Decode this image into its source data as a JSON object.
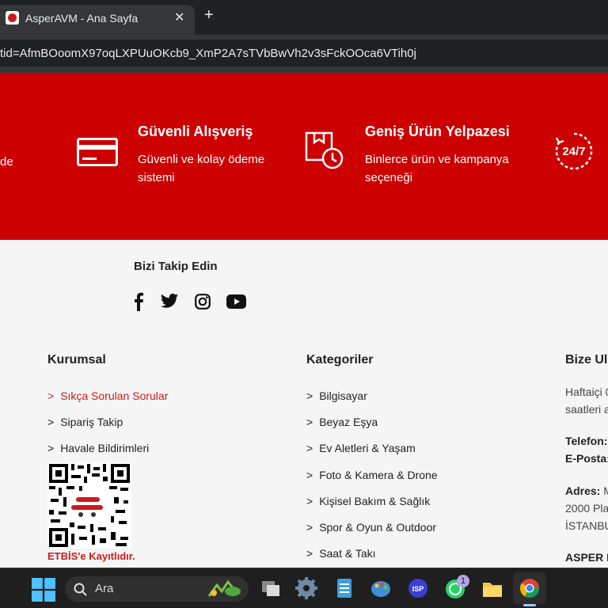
{
  "browser": {
    "tab_title": "AsperAVM - Ana Sayfa",
    "tab_close": "✕",
    "new_tab": "+",
    "url": "tid=AfmBOoomX97oqLXPUuOKcb9_XmP2A7sTVbBwVh2v3sFckOOca6VTih0j"
  },
  "features": {
    "cut_left_text": "de",
    "items": [
      {
        "title": "Güvenli Alışveriş",
        "desc_line1": "Güvenli ve kolay ödeme",
        "desc_line2": "sistemi",
        "icon": "credit-card-icon"
      },
      {
        "title": "Geniş Ürün Yelpazesi",
        "desc_line1": "Binlerce ürün ve kampanya",
        "desc_line2": "seçeneği",
        "icon": "product-box-icon"
      }
    ],
    "support_icon_text": "24/7"
  },
  "social": {
    "title": "Bizi Takip Edin",
    "icons": [
      "facebook-icon",
      "twitter-icon",
      "instagram-icon",
      "youtube-icon"
    ]
  },
  "footer": {
    "kurumsal": {
      "title": "Kurumsal",
      "links": [
        "Sıkça Sorulan Sorular",
        "Sipariş Takip",
        "Havale Bildirimleri"
      ]
    },
    "etbis_label": "ETBİS'e Kayıtlıdır.",
    "kategoriler": {
      "title": "Kategoriler",
      "links": [
        "Bilgisayar",
        "Beyaz Eşya",
        "Ev Aletleri & Yaşam",
        "Foto & Kamera & Drone",
        "Kişisel Bakım & Sağlık",
        "Spor & Oyun & Outdoor",
        "Saat & Takı"
      ]
    },
    "contact": {
      "title": "Bize Ul",
      "hours_1": "Haftaiçi 0",
      "hours_2": "saatleri a",
      "phone_label": "Telefon:",
      "email_label": "E-Posta:",
      "address_label": "Adres:",
      "address_1": "M",
      "address_2": "2000 Pla",
      "address_3": "İSTANBU",
      "company": "ASPER E"
    }
  },
  "taskbar": {
    "search_placeholder": "Ara",
    "whatsapp_badge": "1"
  },
  "colors": {
    "brand_red": "#cc0000",
    "link_red": "#cc1b1b"
  }
}
